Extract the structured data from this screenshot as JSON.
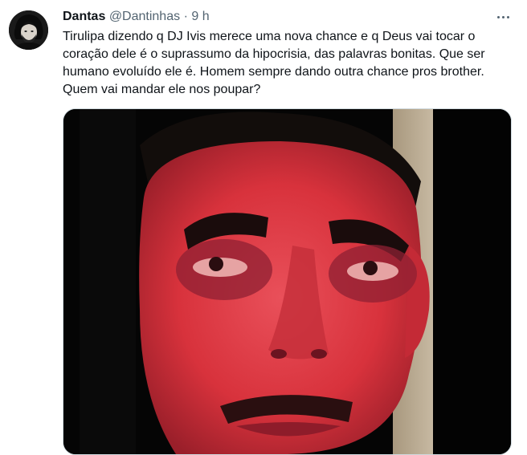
{
  "tweet": {
    "author_name": "Dantas",
    "handle": "@Dantinhas",
    "separator": "·",
    "time": "9 h",
    "text": "Tirulipa dizendo q DJ Ivis merece uma nova chance e q Deus vai tocar o coração dele é o suprassumo da hipocrisia, das palavras bonitas. Que ser humano evoluído ele é. Homem sempre dando outra chance pros brother. Quem vai mandar ele nos poupar?"
  },
  "icons": {
    "more": "more-horizontal-icon"
  },
  "colors": {
    "text_primary": "#0f1419",
    "text_secondary": "#536471",
    "border": "#cfd9de",
    "video_tint": "#d8323c"
  }
}
